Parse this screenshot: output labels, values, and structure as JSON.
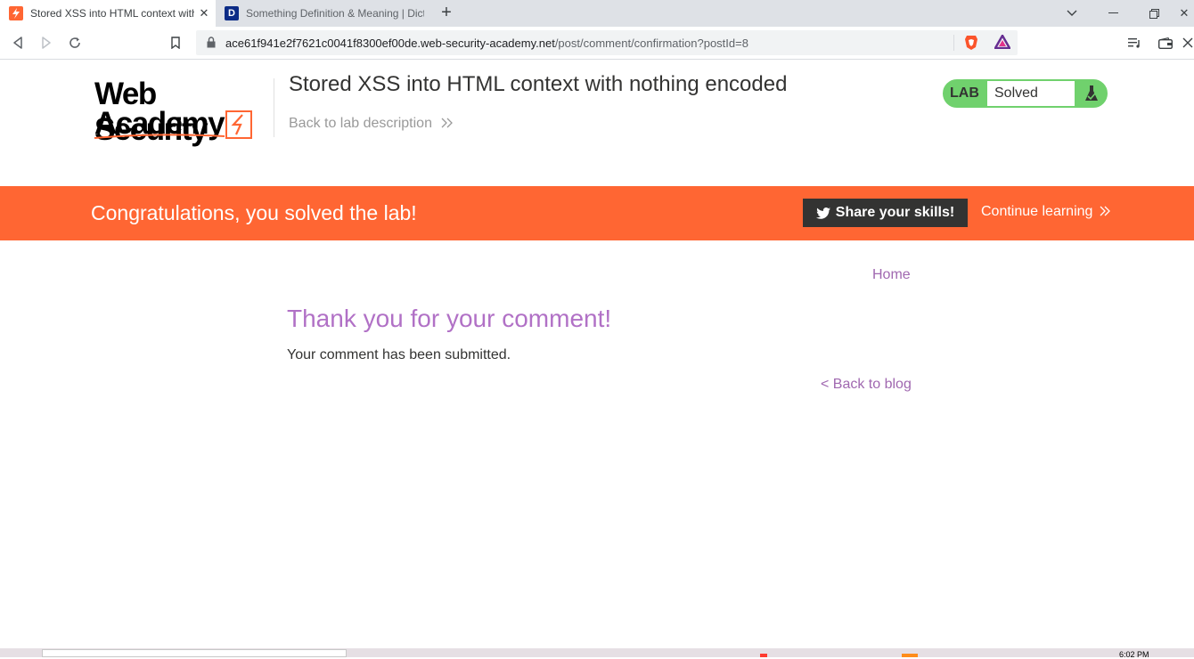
{
  "browser": {
    "tabs": [
      {
        "title": "Stored XSS into HTML context with nothing encoded",
        "active": true
      },
      {
        "title": "Something Definition & Meaning | Dictionary.com",
        "active": false
      }
    ],
    "url_host": "ace61f941e2f7621c0041f8300ef00de.web-security-academy.net",
    "url_path": "/post/comment/confirmation?postId=8"
  },
  "header": {
    "logo_line1": "Web Security",
    "logo_line2": "Academy",
    "lab_title": "Stored XSS into HTML context with nothing encoded",
    "back_to_description": "Back to lab description",
    "badge_label": "LAB",
    "badge_status": "Solved"
  },
  "banner": {
    "message": "Congratulations, you solved the lab!",
    "share_label": "Share your skills!",
    "continue_label": "Continue learning"
  },
  "content": {
    "home_link": "Home",
    "heading": "Thank you for your comment!",
    "body": "Your comment has been submitted.",
    "back_link": "< Back to blog"
  },
  "taskbar": {
    "clock": "6:02 PM"
  },
  "colors": {
    "brand_orange": "#ff6633",
    "badge_green": "#70d16d",
    "link_purple": "#a068b0",
    "heading_purple": "#b171c6"
  }
}
